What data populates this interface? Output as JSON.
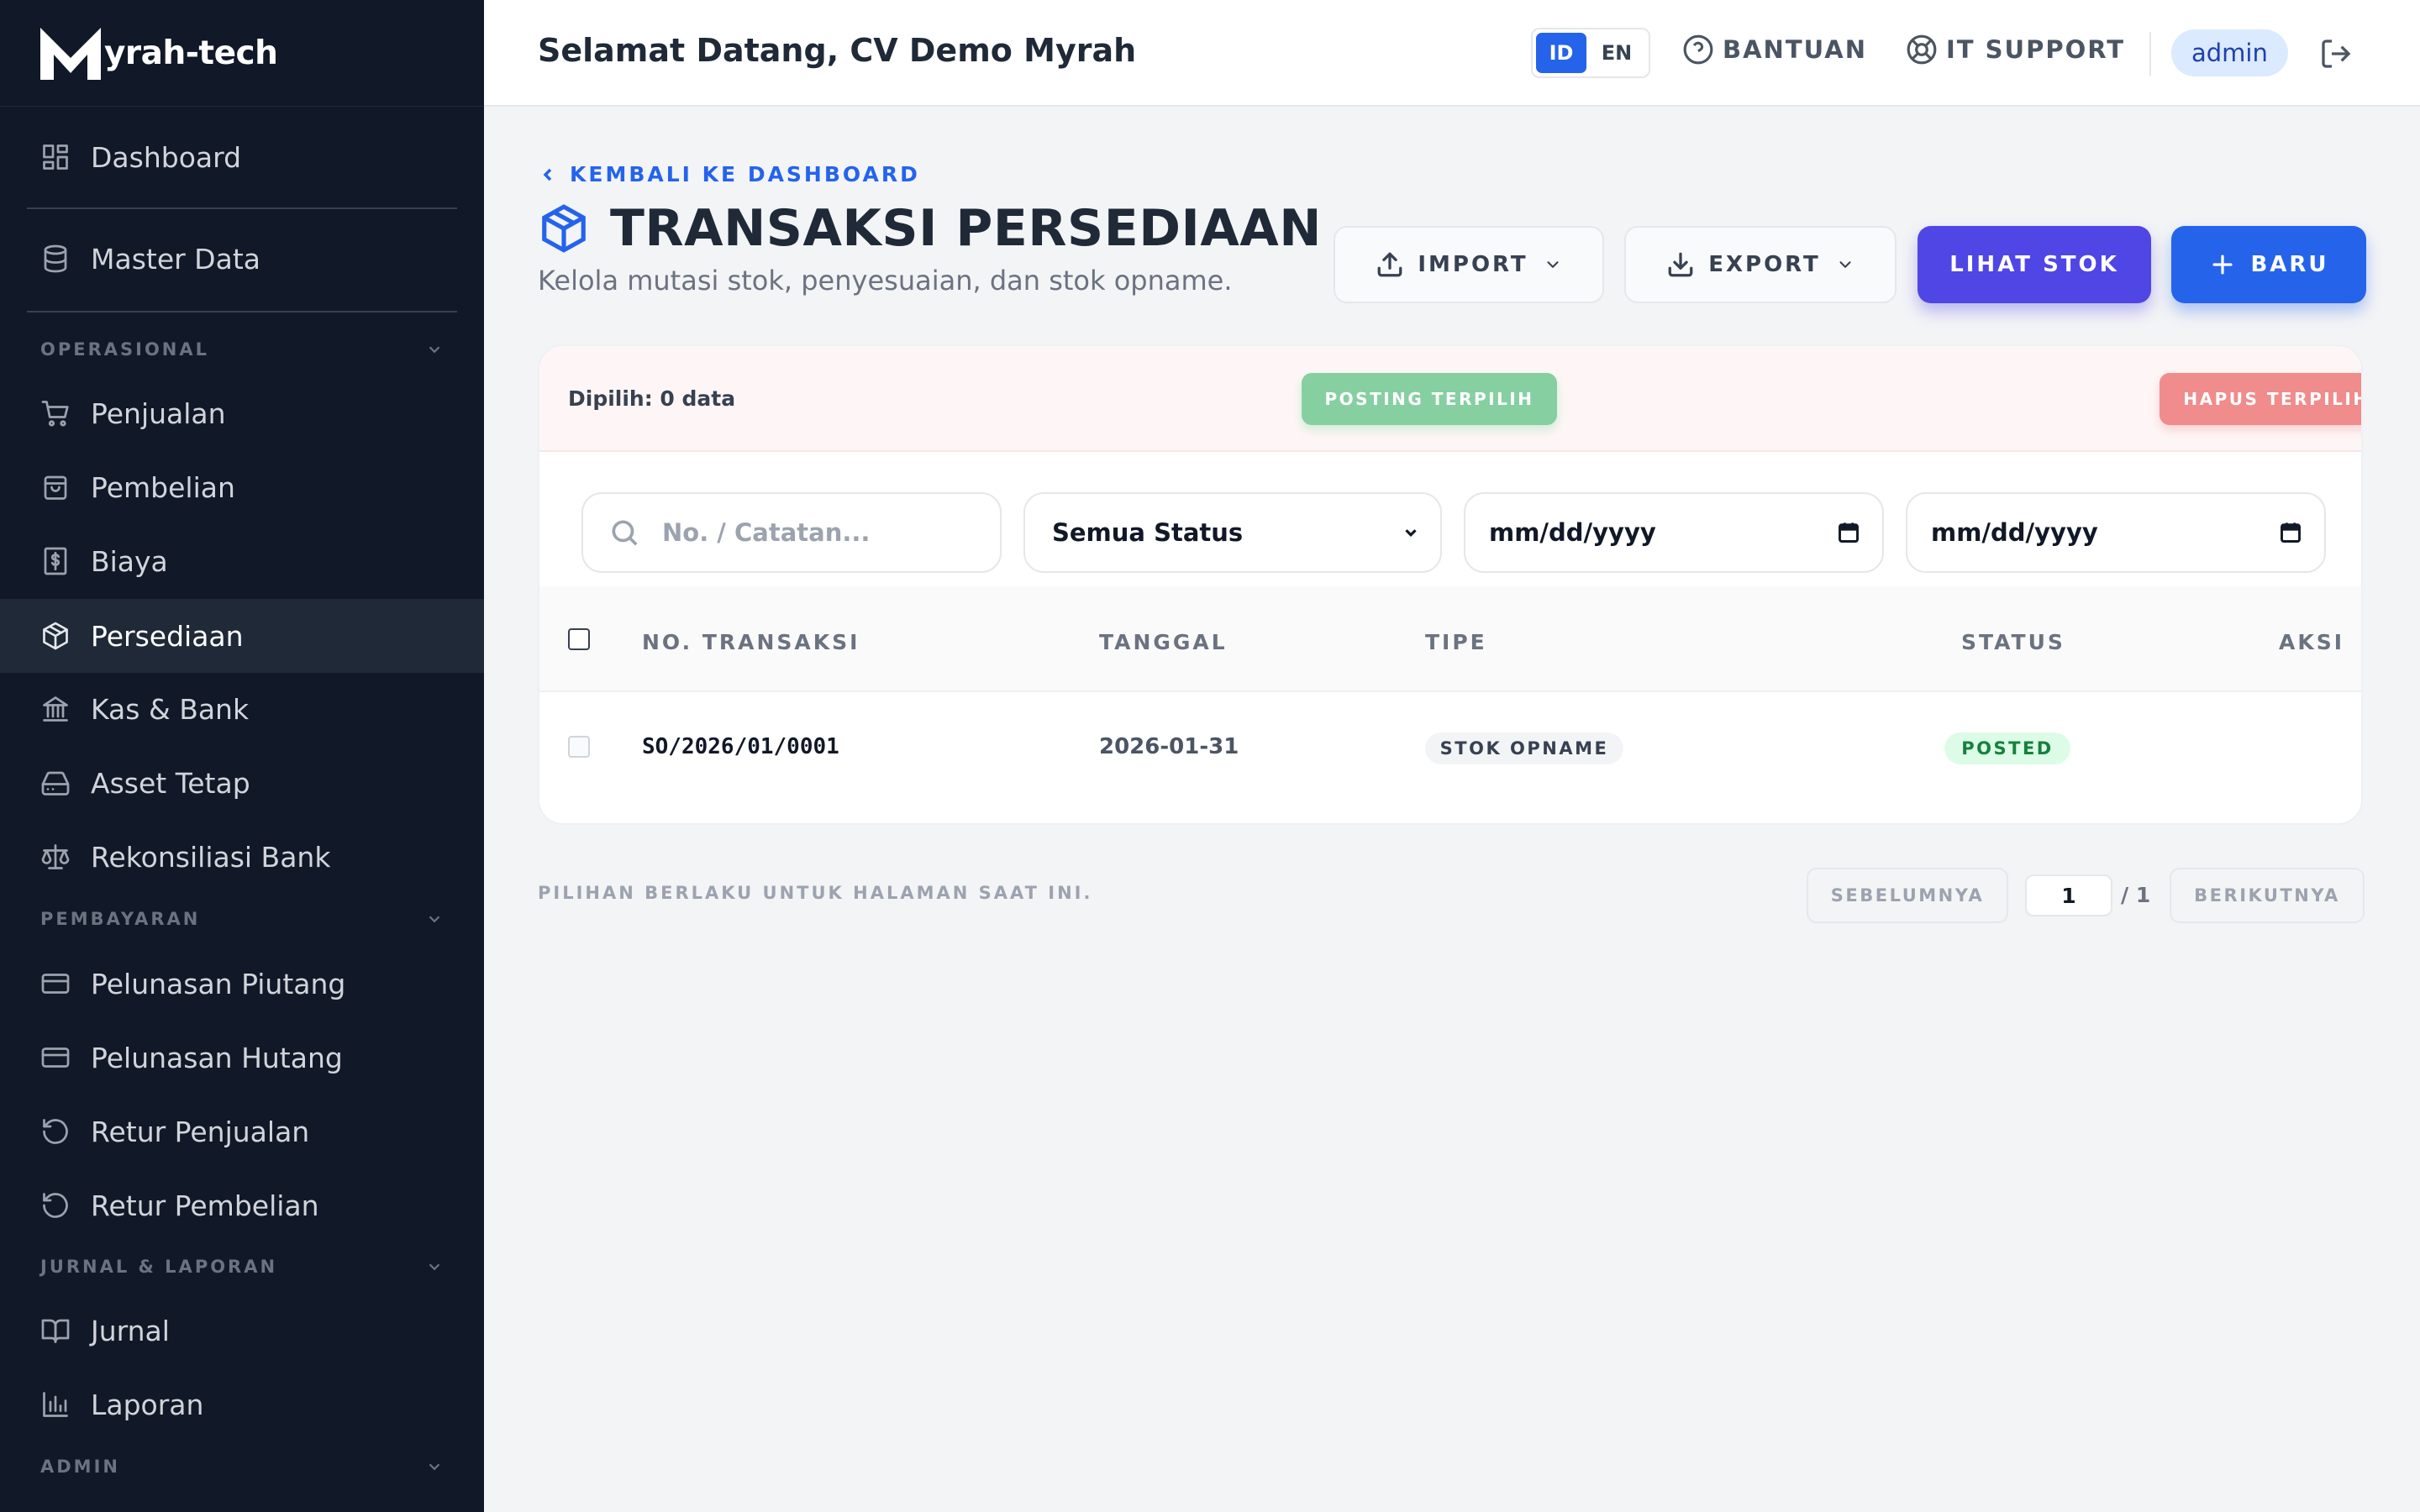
{
  "brand": {
    "name": "yrah-tech",
    "logo_letter": "M"
  },
  "sidebar": {
    "items": [
      {
        "label": "Dashboard"
      },
      {
        "label": "Master Data"
      },
      {
        "label": "Penjualan"
      },
      {
        "label": "Pembelian"
      },
      {
        "label": "Biaya"
      },
      {
        "label": "Persediaan",
        "active": true
      },
      {
        "label": "Kas & Bank"
      },
      {
        "label": "Asset Tetap"
      },
      {
        "label": "Rekonsiliasi Bank"
      },
      {
        "label": "Pelunasan Piutang"
      },
      {
        "label": "Pelunasan Hutang"
      },
      {
        "label": "Retur Penjualan"
      },
      {
        "label": "Retur Pembelian"
      },
      {
        "label": "Jurnal"
      },
      {
        "label": "Laporan"
      }
    ],
    "sections": [
      "OPERASIONAL",
      "PEMBAYARAN",
      "JURNAL & LAPORAN",
      "ADMIN"
    ]
  },
  "header": {
    "welcome": "Selamat Datang, CV Demo Myrah",
    "lang_id": "ID",
    "lang_en": "EN",
    "help": "BANTUAN",
    "support": "IT SUPPORT",
    "user": "admin"
  },
  "page": {
    "back": "KEMBALI KE DASHBOARD",
    "title": "TRANSAKSI PERSEDIAAN",
    "subtitle": "Kelola mutasi stok, penyesuaian, dan stok opname.",
    "import": "IMPORT",
    "export": "EXPORT",
    "view_stock": "LIHAT STOK",
    "new": "BARU"
  },
  "bulk": {
    "selected": "Dipilih: 0 data",
    "post": "POSTING TERPILIH",
    "delete": "HAPUS TERPILIH"
  },
  "filters": {
    "search_placeholder": "No. / Catatan...",
    "status": "Semua Status",
    "date_from": "mm/dd/yyyy",
    "date_to": "mm/dd/yyyy"
  },
  "table": {
    "headers": [
      "NO. TRANSAKSI",
      "TANGGAL",
      "TIPE",
      "STATUS",
      "AKSI"
    ],
    "rows": [
      {
        "no": "SO/2026/01/0001",
        "date": "2026-01-31",
        "type": "STOK OPNAME",
        "status": "POSTED"
      }
    ]
  },
  "footer": {
    "note": "PILIHAN BERLAKU UNTUK HALAMAN SAAT INI.",
    "prev": "SEBELUMNYA",
    "page": "1",
    "total": "/ 1",
    "next": "BERIKUTNYA"
  },
  "colors": {
    "sidebar_bg": "#111827",
    "primary": "#2563eb",
    "indigo": "#4f46e5",
    "success": "#15803d",
    "danger": "#f08c8c"
  }
}
